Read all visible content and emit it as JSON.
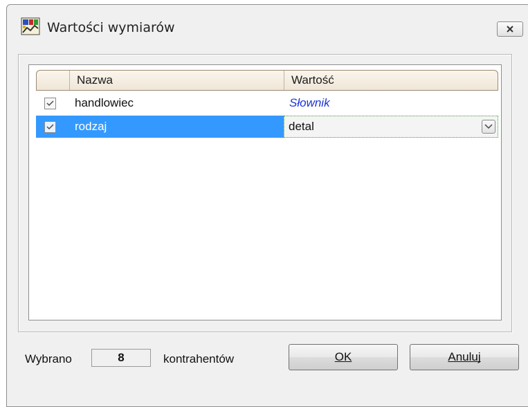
{
  "window": {
    "title": "Wartości wymiarów"
  },
  "grid": {
    "columns": [
      {
        "label": ""
      },
      {
        "label": "Nazwa"
      },
      {
        "label": "Wartość"
      }
    ],
    "rows": [
      {
        "checked": true,
        "name": "handlowiec",
        "value": "Słownik",
        "value_style": "link",
        "selected": false
      },
      {
        "checked": true,
        "name": "rodzaj",
        "value": "detal",
        "value_style": "combo",
        "selected": true
      }
    ]
  },
  "footer": {
    "selected_prefix": "Wybrano",
    "selected_count": "8",
    "selected_suffix": "kontrahentów",
    "ok_label": "OK",
    "cancel_label": "Anuluj"
  },
  "colors": {
    "selection": "#3399ff",
    "dictionary_link": "#1a35d6",
    "header_bg": "#f3ebdf",
    "window_bg": "#f0f0f0"
  },
  "icons": {
    "app": "chart-app-icon",
    "close": "close-icon",
    "checkbox": "checkmark-icon",
    "combo": "chevron-down-icon"
  }
}
